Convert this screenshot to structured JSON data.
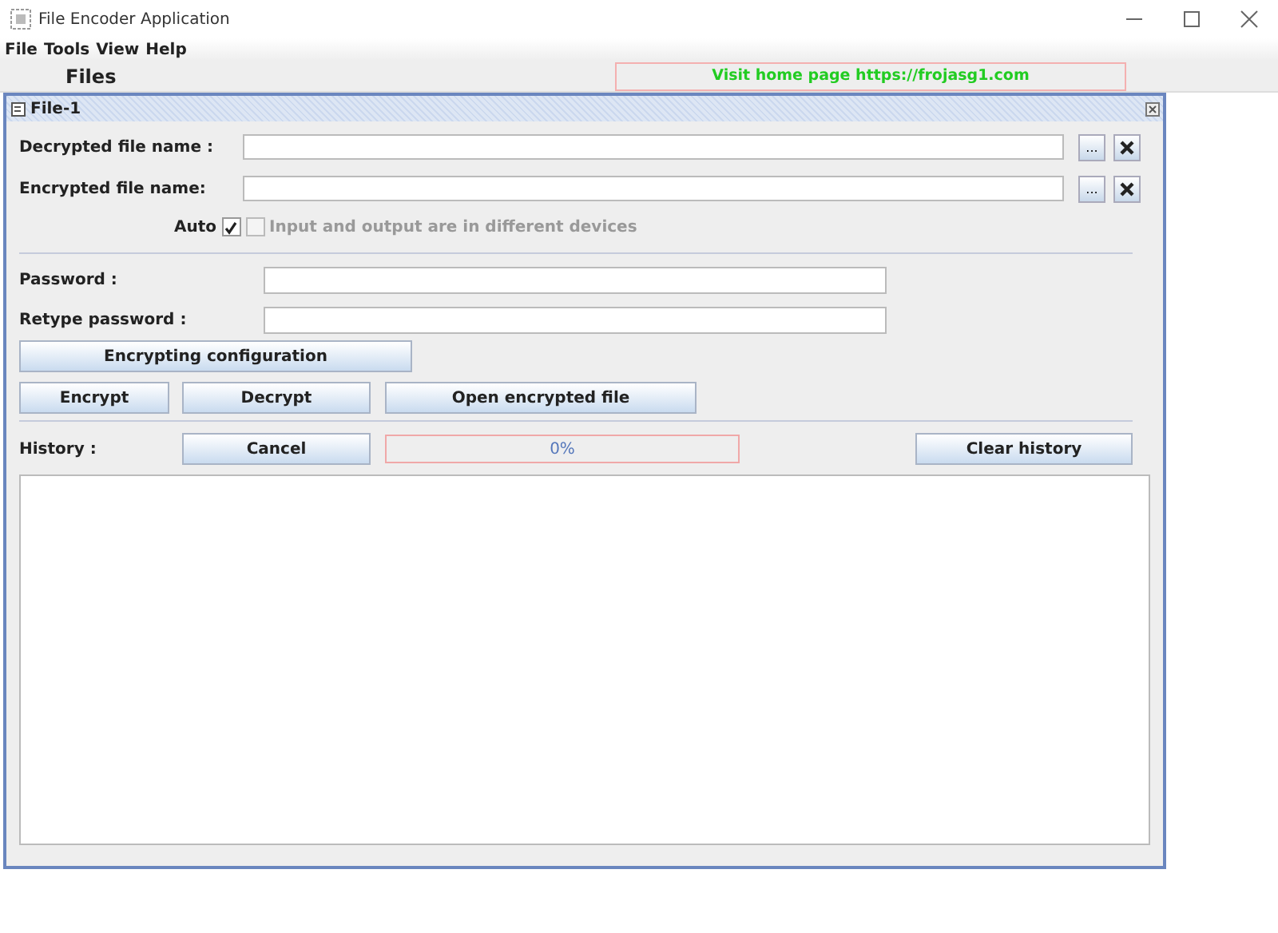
{
  "window": {
    "title": "File Encoder Application"
  },
  "menu": [
    "File",
    "Tools",
    "View",
    "Help"
  ],
  "files_label": "Files",
  "home_link": "Visit home page https://frojasg1.com",
  "frame": {
    "title": "File-1",
    "file_rows": [
      {
        "label": "Decrypted file name :",
        "browse": "..."
      },
      {
        "label": "Encrypted file name:",
        "browse": "..."
      }
    ],
    "auto": {
      "label": "Auto",
      "checked": true
    },
    "devices": {
      "label": "Input and output are in different devices",
      "checked": false,
      "disabled": true
    },
    "password_rows": [
      {
        "label": "Password :"
      },
      {
        "label": "Retype password :"
      }
    ],
    "config_button": "Encrypting configuration",
    "action_buttons": [
      "Encrypt",
      "Decrypt",
      "Open encrypted file"
    ],
    "history_label": "History :",
    "cancel_button": "Cancel",
    "progress": {
      "level": 0,
      "text": "0%"
    },
    "clear_button": "Clear history"
  }
}
